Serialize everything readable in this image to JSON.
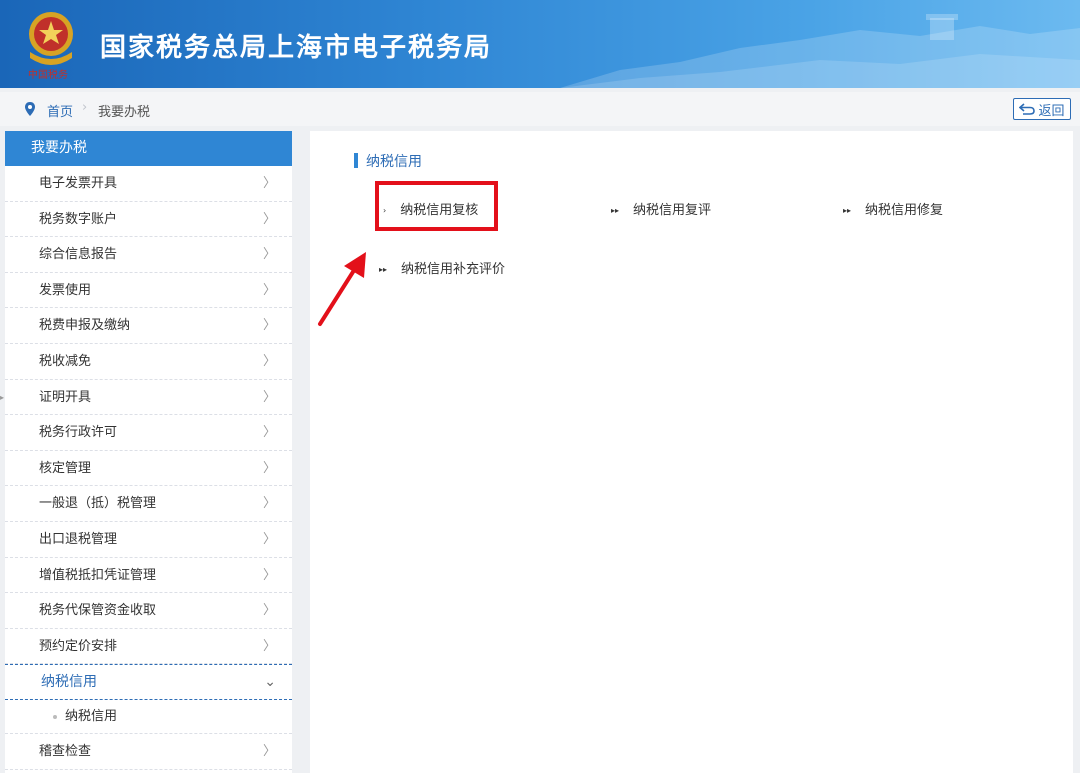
{
  "header": {
    "title": "国家税务总局上海市电子税务局",
    "gradient_colors": [
      "#1a66b8",
      "#6cbaf0"
    ]
  },
  "breadcrumb": {
    "home": "首页",
    "current": "我要办税"
  },
  "back_button": {
    "label": "返回"
  },
  "sidebar": {
    "header": "我要办税",
    "items": [
      {
        "label": "电子发票开具"
      },
      {
        "label": "税务数字账户"
      },
      {
        "label": "综合信息报告"
      },
      {
        "label": "发票使用"
      },
      {
        "label": "税费申报及缴纳"
      },
      {
        "label": "税收减免"
      },
      {
        "label": "证明开具"
      },
      {
        "label": "税务行政许可"
      },
      {
        "label": "核定管理"
      },
      {
        "label": "一般退（抵）税管理"
      },
      {
        "label": "出口退税管理"
      },
      {
        "label": "增值税抵扣凭证管理"
      },
      {
        "label": "税务代保管资金收取"
      },
      {
        "label": "预约定价安排"
      }
    ],
    "active_item": {
      "label": "纳税信用",
      "expanded": true
    },
    "sub_item": {
      "label": "纳税信用"
    },
    "last_item": {
      "label": "稽查检查"
    },
    "accent_color": "#2f86d4"
  },
  "main": {
    "section_title": "纳税信用",
    "links": [
      {
        "label": "纳税信用复核",
        "highlighted": true
      },
      {
        "label": "纳税信用复评"
      },
      {
        "label": "纳税信用修复"
      },
      {
        "label": "纳税信用补充评价"
      }
    ],
    "annotation_color": "#e3101a"
  }
}
